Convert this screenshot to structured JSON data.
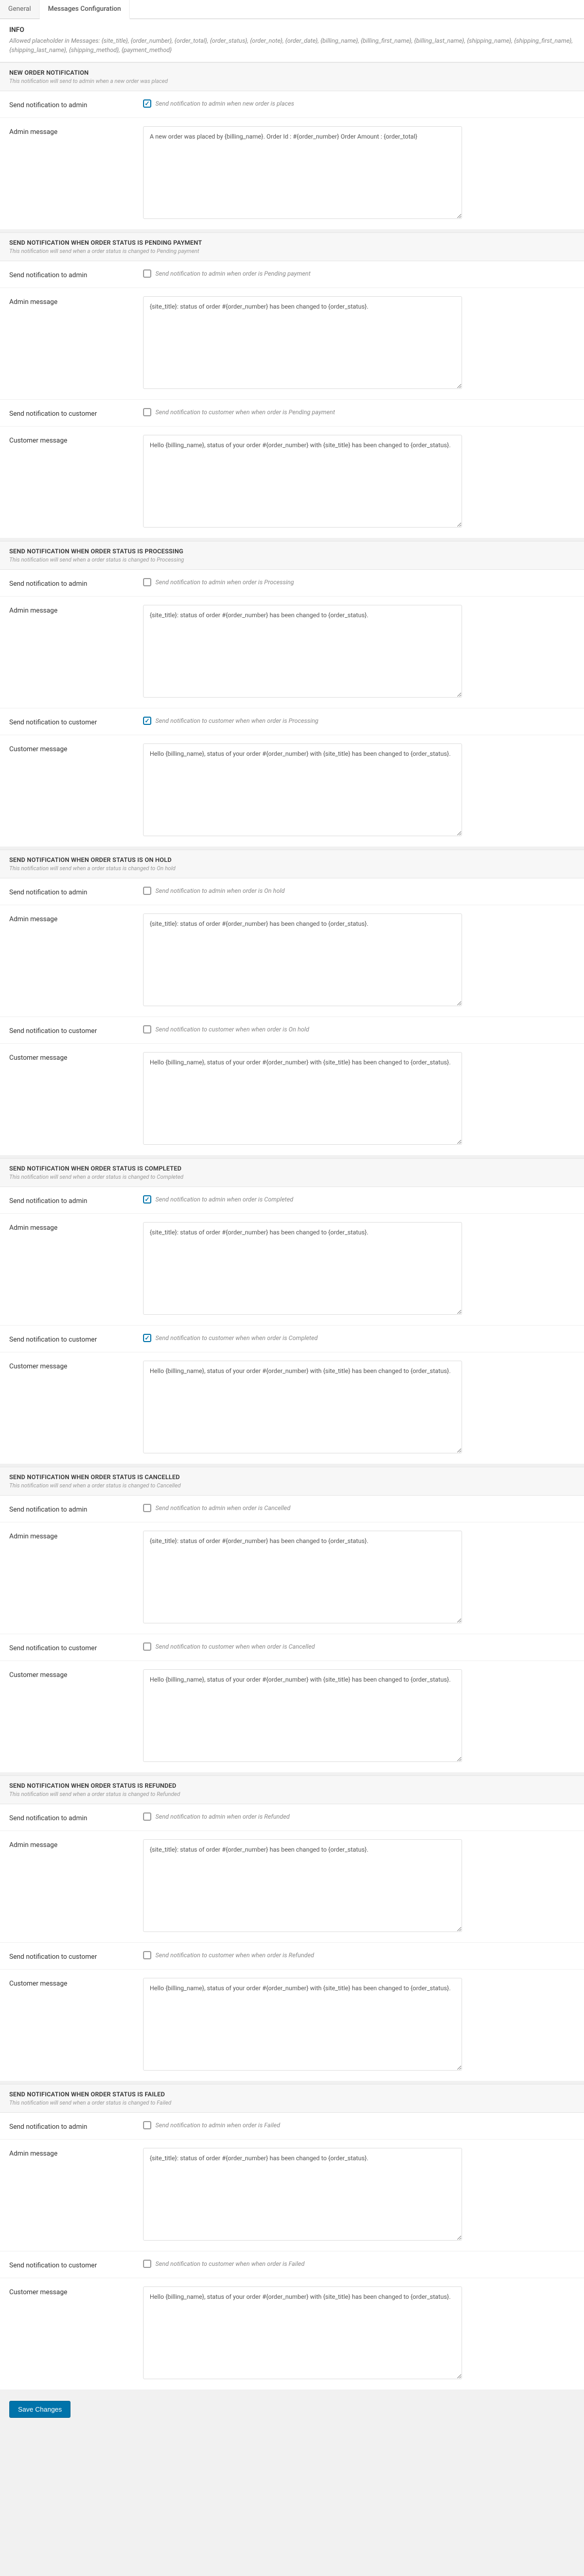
{
  "tabs": {
    "general": "General",
    "messages": "Messages Configuration"
  },
  "info": {
    "title": "INFO",
    "text": "Allowed placeholder in Messages: {site_title}, {order_number}, {order_total}, {order_status}, {order_note}, {order_date}, {billing_name}, {billing_first_name}, {billing_last_name}, {shipping_name}, {shipping_first_name}, {shipping_last_name}, {shipping_method}, {payment_method}"
  },
  "sections": [
    {
      "title": "NEW ORDER NOTIFICATION",
      "desc": "This notification will send to admin when a new order was placed",
      "adminCheckLabel": "Send notification to admin",
      "adminCheckDesc": "Send notification to admin when new order is places",
      "adminChecked": true,
      "adminMsgLabel": "Admin message",
      "adminMsg": "A new order was placed by {billing_name}. Order Id : #{order_number} Order Amount : {order_total}",
      "hasCustomer": false
    },
    {
      "title": "SEND NOTIFICATION WHEN ORDER STATUS IS PENDING PAYMENT",
      "desc": "This notification will send when a order status is changed to Pending payment",
      "adminCheckLabel": "Send notification to admin",
      "adminCheckDesc": "Send notification to admin when order is Pending payment",
      "adminChecked": false,
      "adminMsgLabel": "Admin message",
      "adminMsg": "{site_title}: status of order #{order_number} has been changed to {order_status}.",
      "hasCustomer": true,
      "custCheckLabel": "Send notification to customer",
      "custCheckDesc": "Send notification to customer when when order is Pending payment",
      "custChecked": false,
      "custMsgLabel": "Customer message",
      "custMsg": "Hello {billing_name}, status of your order #{order_number} with {site_title} has been changed to {order_status}."
    },
    {
      "title": "SEND NOTIFICATION WHEN ORDER STATUS IS PROCESSING",
      "desc": "This notification will send when a order status is changed to Processing",
      "adminCheckLabel": "Send notification to admin",
      "adminCheckDesc": "Send notification to admin when order is Processing",
      "adminChecked": false,
      "adminMsgLabel": "Admin message",
      "adminMsg": "{site_title}: status of order #{order_number} has been changed to {order_status}.",
      "hasCustomer": true,
      "custCheckLabel": "Send notification to customer",
      "custCheckDesc": "Send notification to customer when when order is Processing",
      "custChecked": true,
      "custMsgLabel": "Customer message",
      "custMsg": "Hello {billing_name}, status of your order #{order_number} with {site_title} has been changed to {order_status}."
    },
    {
      "title": "SEND NOTIFICATION WHEN ORDER STATUS IS ON HOLD",
      "desc": "This notification will send when a order status is changed to On hold",
      "adminCheckLabel": "Send notification to admin",
      "adminCheckDesc": "Send notification to admin when order is On hold",
      "adminChecked": false,
      "adminMsgLabel": "Admin message",
      "adminMsg": "{site_title}: status of order #{order_number} has been changed to {order_status}.",
      "hasCustomer": true,
      "custCheckLabel": "Send notification to customer",
      "custCheckDesc": "Send notification to customer when when order is On hold",
      "custChecked": false,
      "custMsgLabel": "Customer message",
      "custMsg": "Hello {billing_name}, status of your order #{order_number} with {site_title} has been changed to {order_status}."
    },
    {
      "title": "SEND NOTIFICATION WHEN ORDER STATUS IS COMPLETED",
      "desc": "This notification will send when a order status is changed to Completed",
      "adminCheckLabel": "Send notification to admin",
      "adminCheckDesc": "Send notification to admin when order is Completed",
      "adminChecked": true,
      "adminMsgLabel": "Admin message",
      "adminMsg": "{site_title}: status of order #{order_number} has been changed to {order_status}.",
      "hasCustomer": true,
      "custCheckLabel": "Send notification to customer",
      "custCheckDesc": "Send notification to customer when when order is Completed",
      "custChecked": true,
      "custMsgLabel": "Customer message",
      "custMsg": "Hello {billing_name}, status of your order #{order_number} with {site_title} has been changed to {order_status}."
    },
    {
      "title": "SEND NOTIFICATION WHEN ORDER STATUS IS CANCELLED",
      "desc": "This notification will send when a order status is changed to Cancelled",
      "adminCheckLabel": "Send notification to admin",
      "adminCheckDesc": "Send notification to admin when order is Cancelled",
      "adminChecked": false,
      "adminMsgLabel": "Admin message",
      "adminMsg": "{site_title}: status of order #{order_number} has been changed to {order_status}.",
      "hasCustomer": true,
      "custCheckLabel": "Send notification to customer",
      "custCheckDesc": "Send notification to customer when when order is Cancelled",
      "custChecked": false,
      "custMsgLabel": "Customer message",
      "custMsg": "Hello {billing_name}, status of your order #{order_number} with {site_title} has been changed to {order_status}."
    },
    {
      "title": "SEND NOTIFICATION WHEN ORDER STATUS IS REFUNDED",
      "desc": "This notification will send when a order status is changed to Refunded",
      "adminCheckLabel": "Send notification to admin",
      "adminCheckDesc": "Send notification to admin when order is Refunded",
      "adminChecked": false,
      "adminMsgLabel": "Admin message",
      "adminMsg": "{site_title}: status of order #{order_number} has been changed to {order_status}.",
      "hasCustomer": true,
      "custCheckLabel": "Send notification to customer",
      "custCheckDesc": "Send notification to customer when when order is Refunded",
      "custChecked": false,
      "custMsgLabel": "Customer message",
      "custMsg": "Hello {billing_name}, status of your order #{order_number} with {site_title} has been changed to {order_status}."
    },
    {
      "title": "SEND NOTIFICATION WHEN ORDER STATUS IS FAILED",
      "desc": "This notification will send when a order status is changed to Failed",
      "adminCheckLabel": "Send notification to admin",
      "adminCheckDesc": "Send notification to admin when order is Failed",
      "adminChecked": false,
      "adminMsgLabel": "Admin message",
      "adminMsg": "{site_title}: status of order #{order_number} has been changed to {order_status}.",
      "hasCustomer": true,
      "custCheckLabel": "Send notification to customer",
      "custCheckDesc": "Send notification to customer when when order is Failed",
      "custChecked": false,
      "custMsgLabel": "Customer message",
      "custMsg": "Hello {billing_name}, status of your order #{order_number} with {site_title} has been changed to {order_status}."
    }
  ],
  "saveBtn": "Save Changes"
}
